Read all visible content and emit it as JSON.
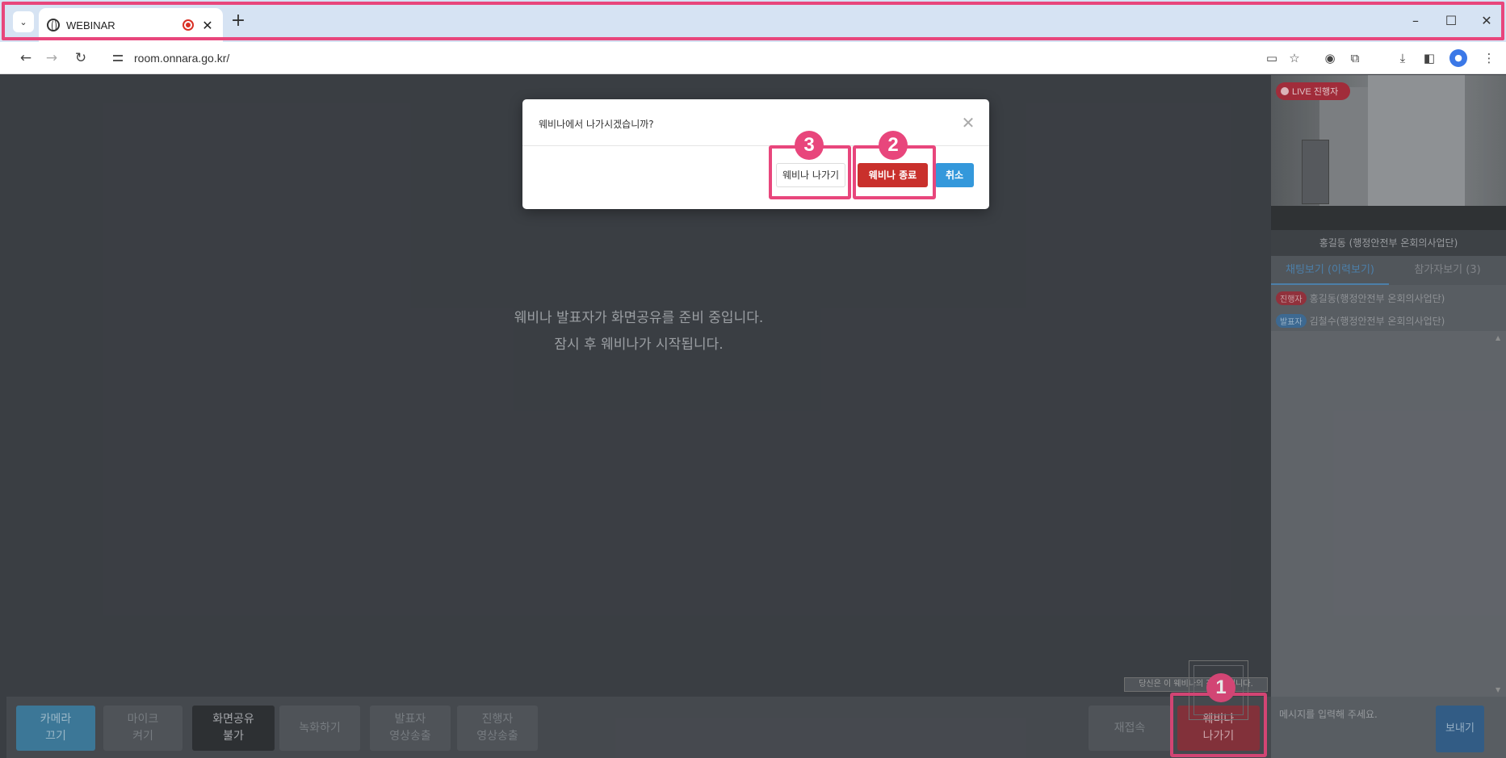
{
  "browser": {
    "tab_title": "WEBINAR",
    "url": "room.onnara.go.kr/",
    "new_tab": "+",
    "minimize": "–",
    "maximize": "☐",
    "close": "✕"
  },
  "stage": {
    "message_line1": "웨비나 발표자가 화면공유를 준비 중입니다.",
    "message_line2": "잠시 후 웨비나가 시작됩니다."
  },
  "dialog": {
    "title": "웨비나에서 나가시겠습니까?",
    "leave_label": "웨비나 나가기",
    "end_label": "웨비나 종료",
    "cancel_label": "취소"
  },
  "annotations": {
    "badge1": "1",
    "badge2": "2",
    "badge3": "3",
    "color": "#e8467c"
  },
  "toolbar": {
    "camera_l1": "카메라",
    "camera_l2": "끄기",
    "mic_l1": "마이크",
    "mic_l2": "켜기",
    "share_l1": "화면공유",
    "share_l2": "불가",
    "record": "녹화하기",
    "presenter_l1": "발표자",
    "presenter_l2": "영상송출",
    "host_l1": "진행자",
    "host_l2": "영상송출",
    "reconnect": "재접속",
    "exit_l1": "웨비나",
    "exit_l2": "나가기",
    "tooltip": "당신은 이 웨비나의 진행자입니다."
  },
  "sidebar": {
    "live_badge": "LIVE 진행자",
    "host_name": "홍길동 (행정안전부 온회의사업단)",
    "tab_chat": "채팅보기 (이력보기)",
    "tab_participants": "참가자보기 (3)",
    "participants": [
      {
        "role": "진행자",
        "name": "홍길동(행정안전부 온회의사업단)"
      },
      {
        "role": "발표자",
        "name": "김철수(행정안전부 온회의사업단)"
      }
    ],
    "chat_placeholder": "메시지를 입력해 주세요.",
    "send_label": "보내기"
  }
}
